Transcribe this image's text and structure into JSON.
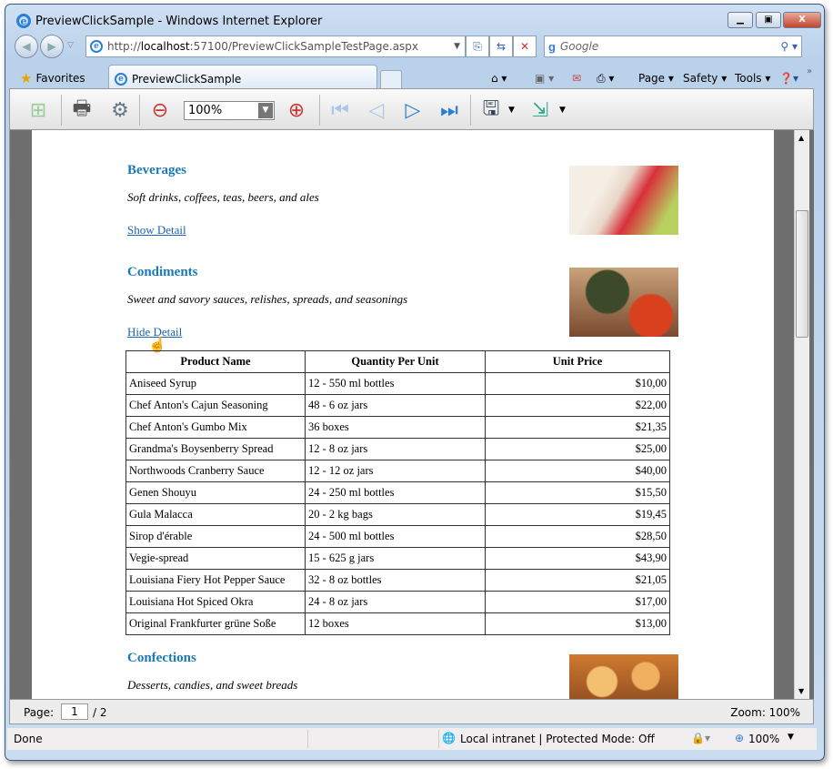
{
  "window": {
    "title": "PreviewClickSample - Windows Internet Explorer"
  },
  "address": {
    "prefix": "http://",
    "host": "localhost",
    "rest": ":57100/PreviewClickSampleTestPage.aspx"
  },
  "search": {
    "placeholder": "Google"
  },
  "favorites": "Favorites",
  "tab": {
    "label": "PreviewClickSample"
  },
  "commands": {
    "page": "Page ▾",
    "safety": "Safety ▾",
    "tools": "Tools ▾"
  },
  "toolbar": {
    "zoom": "100%"
  },
  "categories": [
    {
      "name": "Beverages",
      "description": "Soft drinks, coffees, teas, beers, and ales",
      "link": "Show Detail"
    },
    {
      "name": "Condiments",
      "description": "Sweet and savory sauces, relishes, spreads, and seasonings",
      "link": "Hide Detail"
    },
    {
      "name": "Confections",
      "description": "Desserts, candies, and sweet breads"
    }
  ],
  "table": {
    "headers": [
      "Product Name",
      "Quantity Per Unit",
      "Unit Price"
    ],
    "rows": [
      [
        "Aniseed Syrup",
        "12 - 550 ml bottles",
        "$10,00"
      ],
      [
        "Chef Anton's Cajun Seasoning",
        "48 - 6 oz jars",
        "$22,00"
      ],
      [
        "Chef Anton's Gumbo Mix",
        "36 boxes",
        "$21,35"
      ],
      [
        "Grandma's Boysenberry Spread",
        "12 - 8 oz jars",
        "$25,00"
      ],
      [
        "Northwoods Cranberry Sauce",
        "12 - 12 oz jars",
        "$40,00"
      ],
      [
        "Genen Shouyu",
        "24 - 250 ml bottles",
        "$15,50"
      ],
      [
        "Gula Malacca",
        "20 - 2 kg bags",
        "$19,45"
      ],
      [
        "Sirop d'érable",
        "24 - 500 ml bottles",
        "$28,50"
      ],
      [
        "Vegie-spread",
        "15 - 625 g jars",
        "$43,90"
      ],
      [
        "Louisiana Fiery Hot Pepper Sauce",
        "32 - 8 oz bottles",
        "$21,05"
      ],
      [
        "Louisiana Hot Spiced Okra",
        "24 - 8 oz jars",
        "$17,00"
      ],
      [
        "Original Frankfurter grüne Soße",
        "12 boxes",
        "$13,00"
      ]
    ]
  },
  "pager": {
    "label": "Page:",
    "current": "1",
    "total": "/ 2",
    "zoom": "Zoom: 100%"
  },
  "status": {
    "text": "Done",
    "zone": "Local intranet | Protected Mode: Off",
    "zoom": "100%"
  }
}
